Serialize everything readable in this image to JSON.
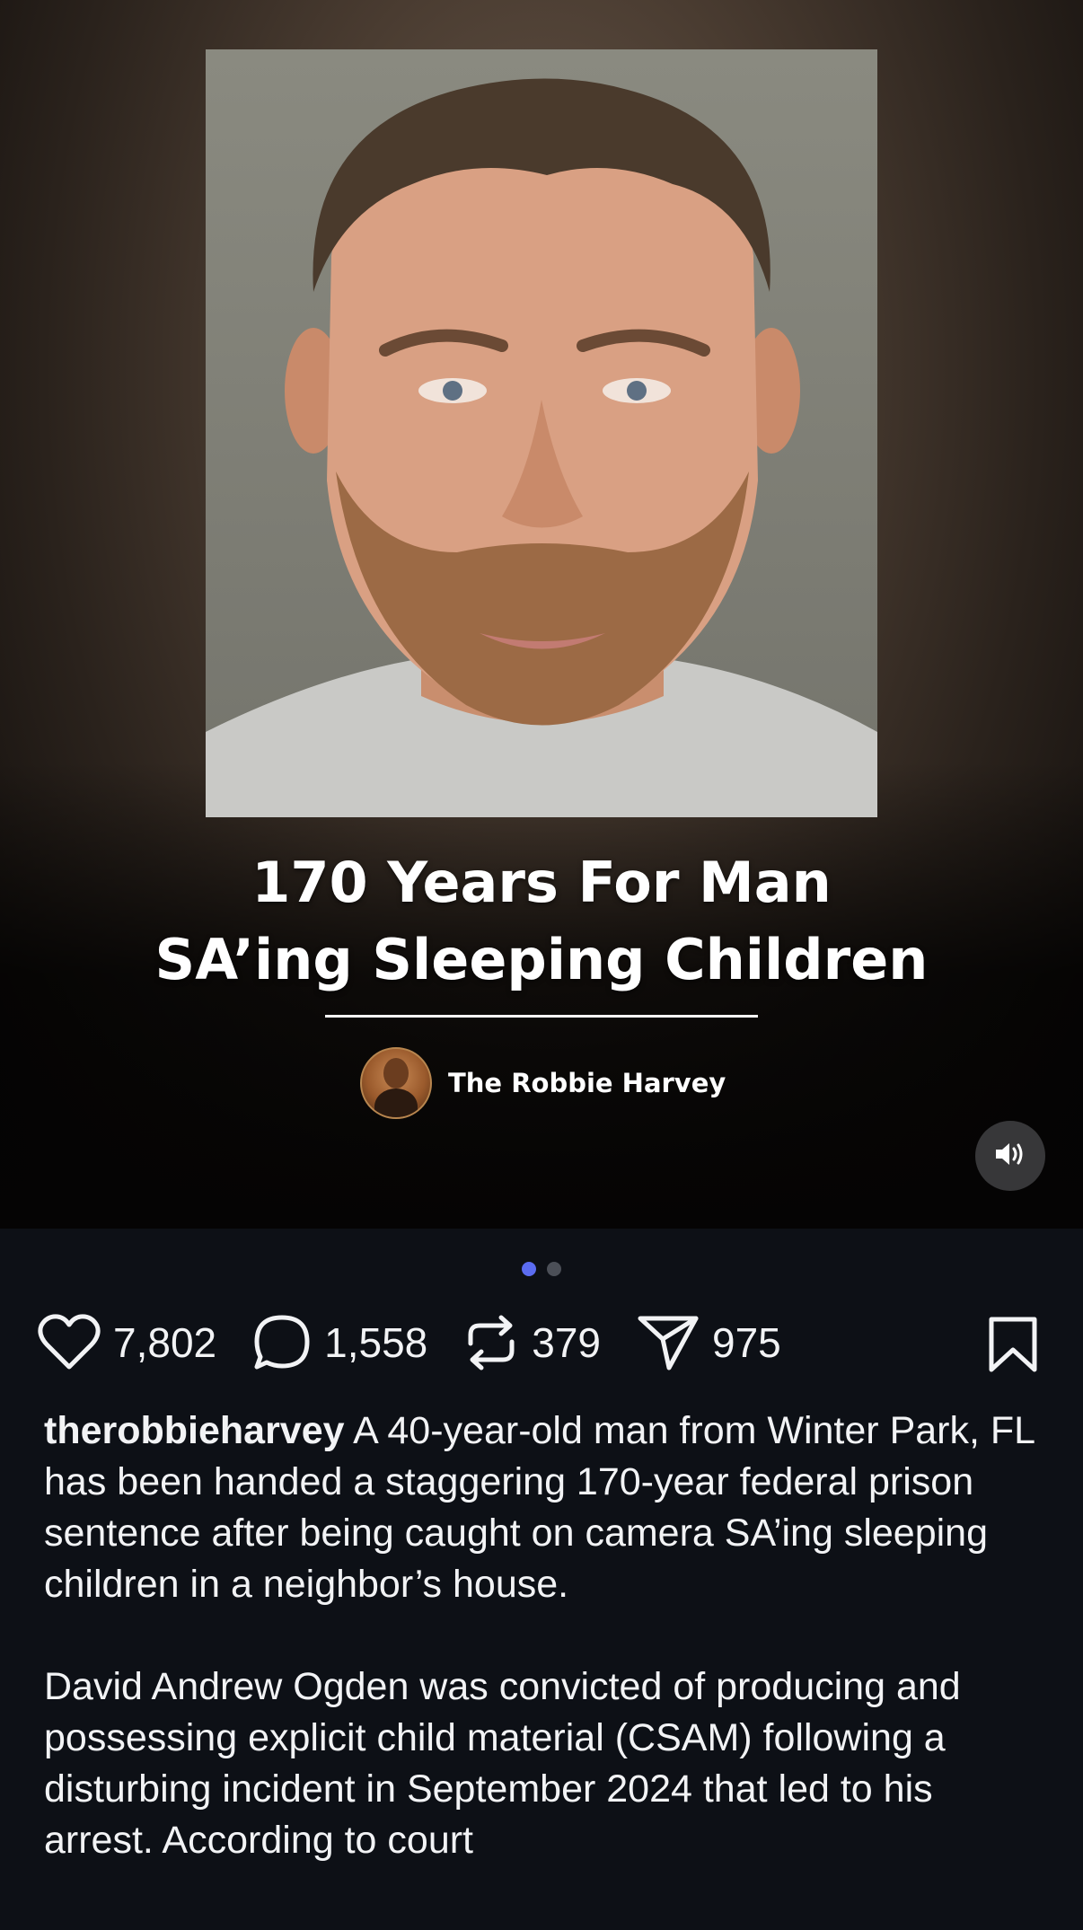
{
  "post": {
    "headline_line1": "170 Years For Man",
    "headline_line2": "SA’ing Sleeping Children",
    "byline": "The Robbie Harvey",
    "carousel": {
      "total": 2,
      "current": 1
    }
  },
  "actions": {
    "likes": "7,802",
    "comments": "1,558",
    "reposts": "379",
    "shares": "975"
  },
  "caption": {
    "username": "therobbieharvey",
    "paragraph1": "A 40-year-old man from Winter Park, FL has been handed a staggering 170-year federal prison sentence after being caught on camera SA’ing sleeping children in a neighbor’s house.",
    "paragraph2": "David Andrew Ogden was convicted of producing and possessing explicit child material (CSAM) following a disturbing incident in September 2024 that led to his arrest. According to court"
  },
  "icons": {
    "like": "heart-icon",
    "comment": "comment-bubble-icon",
    "repost": "repost-arrows-icon",
    "share": "send-paper-plane-icon",
    "save": "bookmark-icon",
    "sound": "speaker-volume-icon"
  },
  "colors": {
    "background": "#0d1016",
    "text": "#f2f3f5",
    "active_dot": "#5b6cf0",
    "inactive_dot": "#4b4f57"
  }
}
